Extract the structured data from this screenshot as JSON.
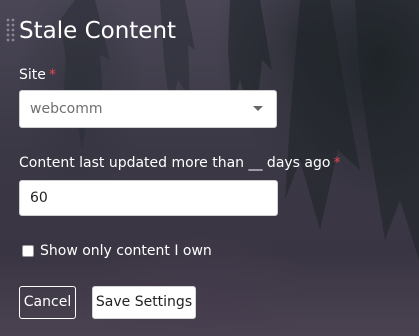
{
  "dialog": {
    "title": "Stale Content"
  },
  "fields": {
    "site": {
      "label": "Site",
      "required_mark": "*",
      "selected_value": "webcomm"
    },
    "days": {
      "label": "Content last updated more than __ days ago",
      "required_mark": "*",
      "value": "60"
    },
    "own_only": {
      "label": "Show only content I own",
      "checked": false
    }
  },
  "buttons": {
    "cancel_label": "Cancel",
    "save_label": "Save Settings"
  },
  "icons": {
    "drag_handle": "drag-handle-icon",
    "dropdown_caret": "chevron-down-icon"
  },
  "colors": {
    "required": "#e8474c",
    "text": "#ffffff",
    "input_bg": "#ffffff"
  }
}
